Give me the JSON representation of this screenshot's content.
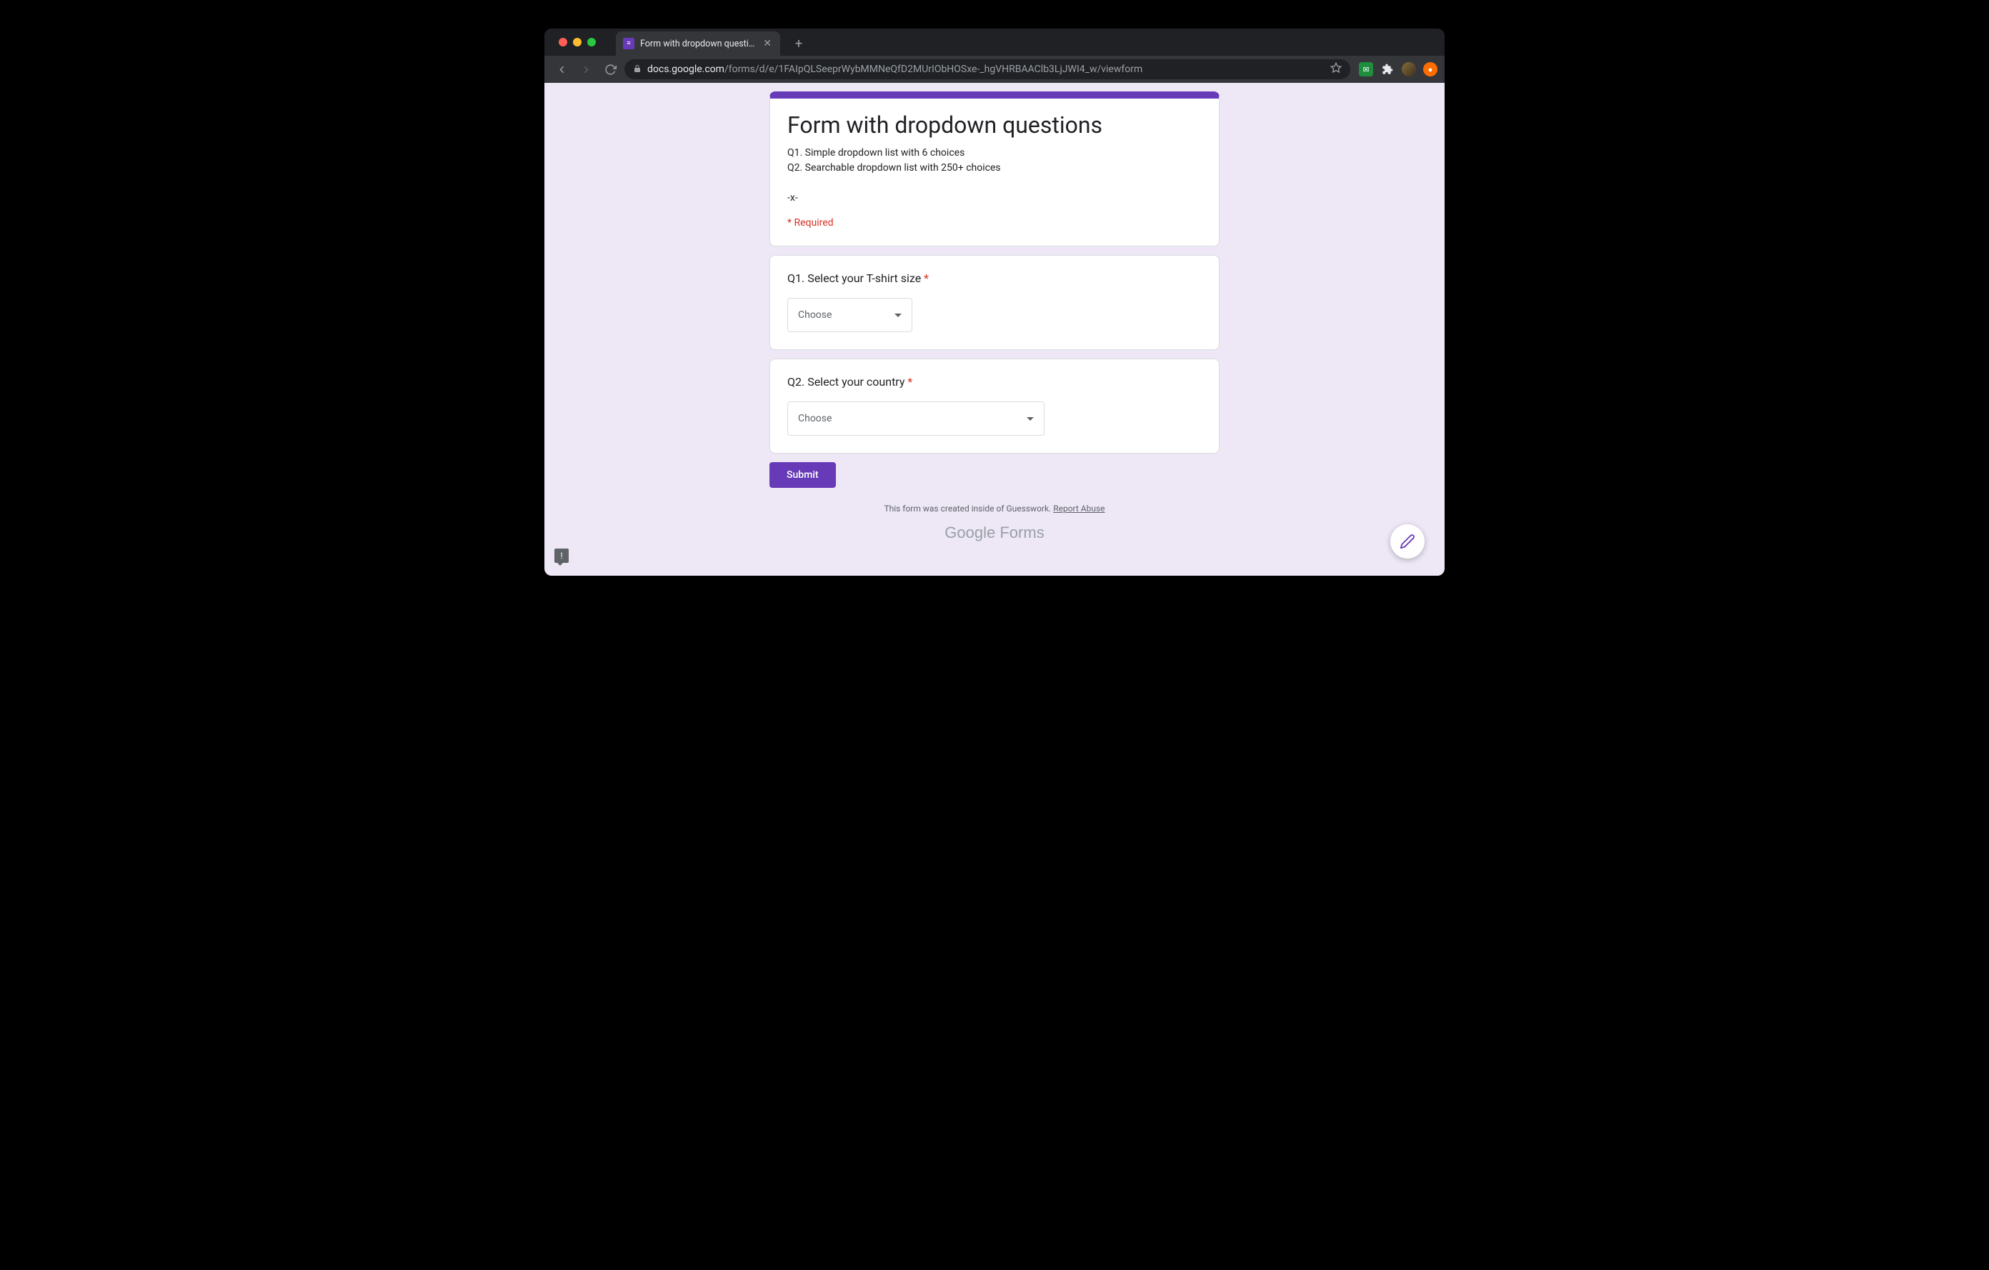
{
  "browser": {
    "tab_title": "Form with dropdown questions",
    "url_host": "docs.google.com",
    "url_path": "/forms/d/e/1FAIpQLSeeprWybMMNeQfD2MUrIObHOSxe-_hgVHRBAAClb3LjJWI4_w/viewform"
  },
  "form": {
    "title": "Form with dropdown questions",
    "description": "Q1. Simple dropdown list with 6 choices\nQ2. Searchable dropdown list with 250+ choices\n\n-x-",
    "required_legend": "* Required",
    "questions": [
      {
        "label": "Q1. Select your T-shirt size",
        "required": true,
        "placeholder": "Choose"
      },
      {
        "label": "Q2. Select your country",
        "required": true,
        "placeholder": "Choose"
      }
    ],
    "submit_label": "Submit"
  },
  "footer": {
    "disclaimer_prefix": "This form was created inside of Guesswork. ",
    "report_abuse": "Report Abuse",
    "brand_google": "Google",
    "brand_forms": " Forms"
  }
}
